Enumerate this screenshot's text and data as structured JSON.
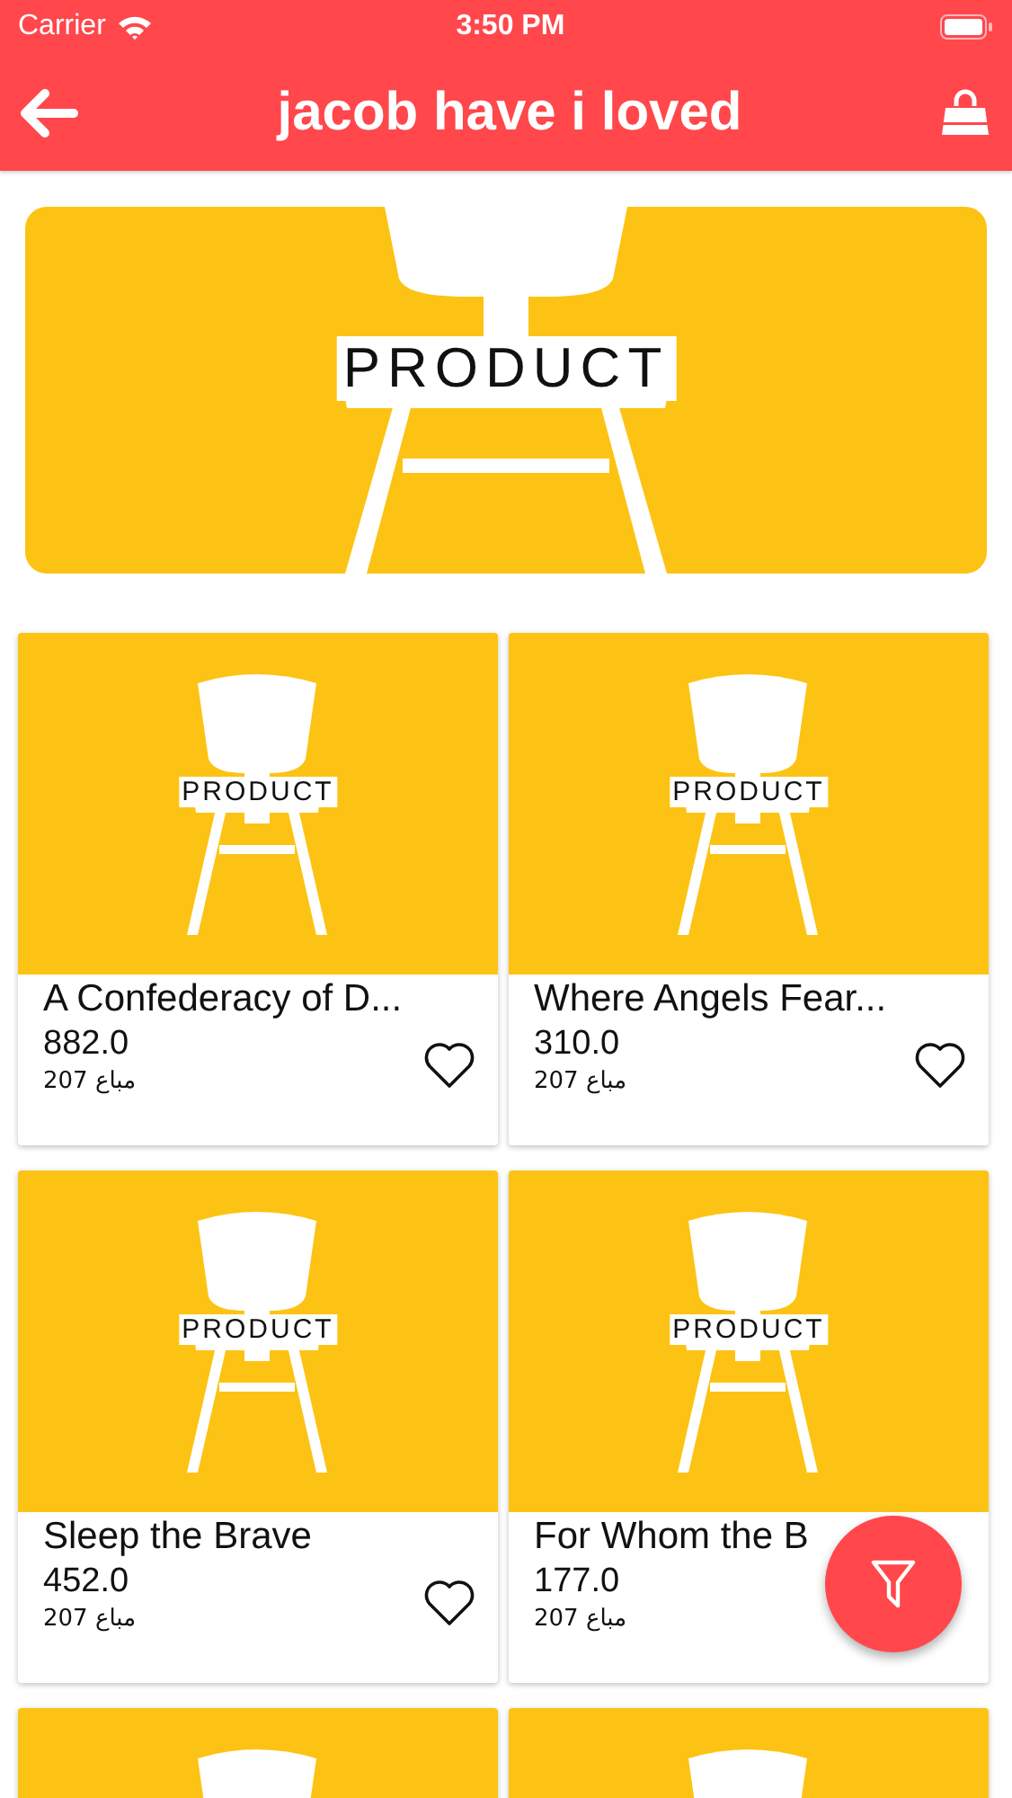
{
  "status_bar": {
    "carrier": "Carrier",
    "time": "3:50 PM"
  },
  "nav": {
    "title": "jacob have i loved"
  },
  "banner": {
    "kind": "picture",
    "label": "PRODUCT"
  },
  "products": [
    {
      "kind": "full",
      "image_label": "PRODUCT",
      "title": "A Confederacy of D...",
      "price": "882.0",
      "sold": "207 مباع",
      "heart": true
    },
    {
      "kind": "full",
      "image_label": "PRODUCT",
      "title": "Where Angels Fear...",
      "price": "310.0",
      "sold": "207 مباع",
      "heart": true
    },
    {
      "kind": "full",
      "image_label": "PRODUCT",
      "title": "Sleep the Brave",
      "price": "452.0",
      "sold": "207 مباع",
      "heart": true
    },
    {
      "kind": "full",
      "image_label": "PRODUCT",
      "title": "For Whom the B",
      "price": "177.0",
      "sold": "207 مباع",
      "heart": false
    },
    {
      "kind": "partial"
    },
    {
      "kind": "partial"
    }
  ]
}
